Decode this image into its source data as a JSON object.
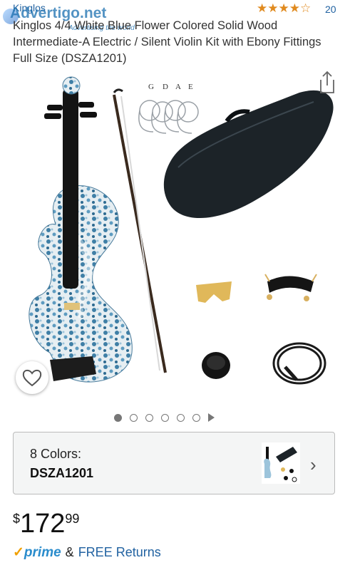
{
  "brand": "Kinglos",
  "watermark": {
    "text": "Advertigo.net",
    "tagline": "Advertising the world"
  },
  "rating": {
    "stars": "★★★★☆",
    "value": 3.5,
    "count": "20"
  },
  "title": "Kinglos 4/4 White Blue Flower Colored Solid Wood Intermediate-A Electric / Silent Violin Kit with Ebony Fittings Full Size (DSZA1201)",
  "gallery": {
    "strings_letters": [
      "G",
      "D",
      "A",
      "E"
    ],
    "image_count": 6,
    "active_index": 0
  },
  "colors": {
    "label": "8 Colors:",
    "selected": "DSZA1201"
  },
  "price": {
    "symbol": "$",
    "whole": "172",
    "fraction": "99"
  },
  "shipping": {
    "prime_check": "✓",
    "prime": "prime",
    "amp": "&",
    "free_returns": "FREE Returns"
  },
  "accent_colors": {
    "link": "#2162a1",
    "star": "#e08a1e",
    "prime": "#2a8ccc"
  }
}
